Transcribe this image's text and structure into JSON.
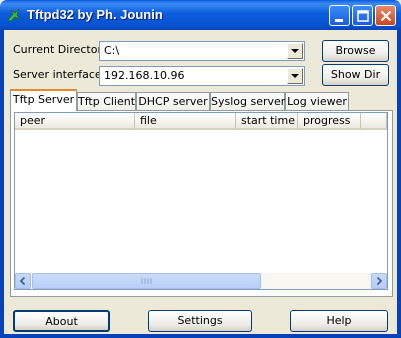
{
  "window": {
    "title": "Tftpd32 by Ph. Jounin"
  },
  "current_directory": {
    "label": "Current Directory",
    "value": "C:\\"
  },
  "server_interfaces": {
    "label": "Server interfaces",
    "value": "192.168.10.96"
  },
  "buttons": {
    "browse": "Browse",
    "show_dir": "Show Dir",
    "about": "About",
    "settings": "Settings",
    "help": "Help"
  },
  "tabs": [
    {
      "label": "Tftp Server",
      "active": true
    },
    {
      "label": "Tftp Client",
      "active": false
    },
    {
      "label": "DHCP server",
      "active": false
    },
    {
      "label": "Syslog server",
      "active": false
    },
    {
      "label": "Log viewer",
      "active": false
    }
  ],
  "table": {
    "columns": [
      "peer",
      "file",
      "start time",
      "progress"
    ],
    "rows": []
  }
}
